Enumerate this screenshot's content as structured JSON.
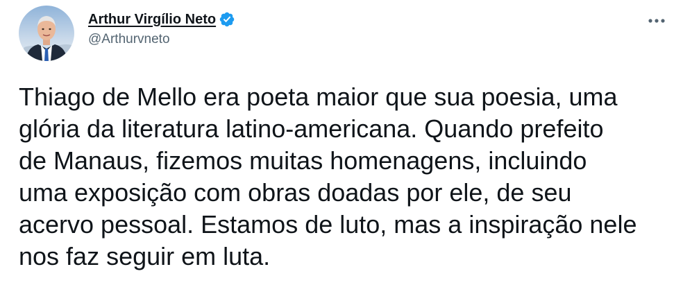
{
  "author": {
    "display_name": "Arthur Virgílio Neto",
    "handle": "@Arthurvneto",
    "verified": true,
    "verified_icon": "verified-badge-icon",
    "avatar_icon": "profile-photo"
  },
  "menu": {
    "more_icon": "more-horizontal-icon"
  },
  "tweet": {
    "text": "Thiago de Mello era poeta maior que sua poesia, uma\nglória da literatura latino-americana. Quando prefeito\nde Manaus, fizemos muitas homenagens, incluindo\numa exposição com obras doadas por ele, de seu\nacervo pessoal. Estamos de luto, mas a inspiração nele\nnos faz seguir em luta."
  },
  "colors": {
    "text": "#0f1419",
    "secondary": "#536471",
    "verified_blue": "#1d9bf0",
    "background": "#ffffff"
  }
}
